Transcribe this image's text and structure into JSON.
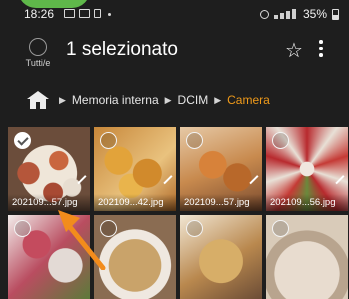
{
  "status_bar": {
    "time": "18:26",
    "battery": "35%"
  },
  "header": {
    "select_all_label": "Tutti/e",
    "title": "1 selezionato"
  },
  "breadcrumb": {
    "items": [
      "Memoria interna",
      "DCIM",
      "Camera"
    ],
    "active_color": "#ef9a1a"
  },
  "grid": {
    "items": [
      {
        "name": "202109...57.jpg",
        "selected": true
      },
      {
        "name": "202109...42.jpg",
        "selected": false
      },
      {
        "name": "202109...57.jpg",
        "selected": false
      },
      {
        "name": "202109...56.jpg",
        "selected": false
      },
      {
        "name": "",
        "selected": false
      },
      {
        "name": "",
        "selected": false
      },
      {
        "name": "",
        "selected": false
      },
      {
        "name": "",
        "selected": false
      }
    ]
  },
  "colors": {
    "background": "#1e1e1e",
    "accent": "#ef9a1a",
    "annotation_arrow": "#f28c1c"
  },
  "icons": [
    "select-all-circle-icon",
    "star-icon",
    "more-vert-icon",
    "home-folder-icon",
    "chevron-right-icon",
    "check-icon",
    "expand-icon"
  ]
}
